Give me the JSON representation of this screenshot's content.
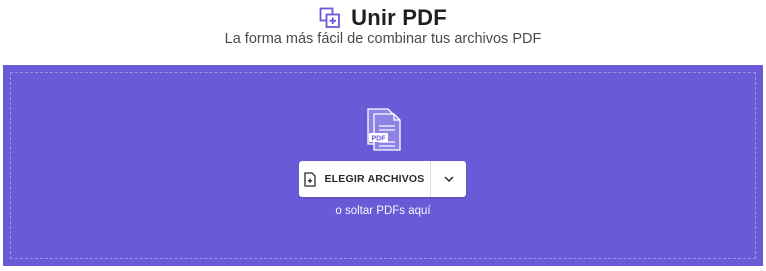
{
  "header": {
    "title": "Unir PDF",
    "subtitle": "La forma más fácil de combinar tus archivos PDF",
    "icon": "merge-pdf-icon",
    "accent_color": "#6a5ad8"
  },
  "dropzone": {
    "background_color": "#6a5ad8",
    "illustration_icon": "pdf-files-icon",
    "illustration_label": "PDF",
    "choose_button_label": "ELEGIR ARCHIVOS",
    "choose_button_icon": "add-file-icon",
    "dropdown_icon": "chevron-down-icon",
    "hint": "o soltar PDFs aquí"
  }
}
